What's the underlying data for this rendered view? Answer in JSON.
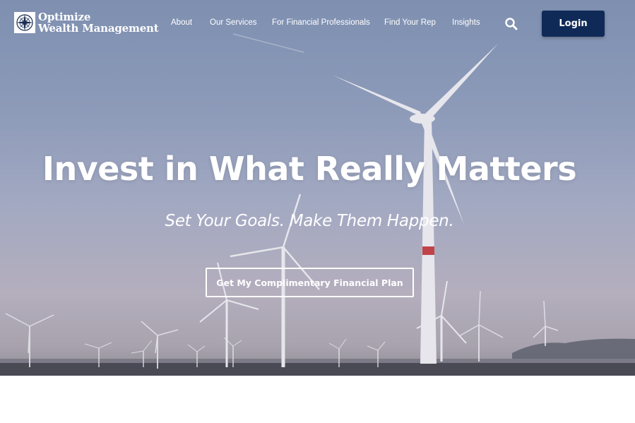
{
  "brand": {
    "name_line1": "Optimize",
    "name_line2": "Wealth Management",
    "logo_icon": "compass-icon"
  },
  "nav": {
    "items": [
      {
        "label": "About"
      },
      {
        "label": "Our Services"
      },
      {
        "label": "For Financial Professionals"
      },
      {
        "label": "Find Your Rep"
      },
      {
        "label": "Insights"
      }
    ],
    "search_icon": "search-icon",
    "login_label": "Login"
  },
  "hero": {
    "headline": "Invest in What Really Matters",
    "subheadline": "Set Your Goals. Make Them Happen.",
    "cta_label": "Get My Complimentary Financial Plan",
    "background": "wind-turbines-photo"
  },
  "colors": {
    "login_bg": "#0f2a57",
    "text_on_hero": "#ffffff"
  }
}
